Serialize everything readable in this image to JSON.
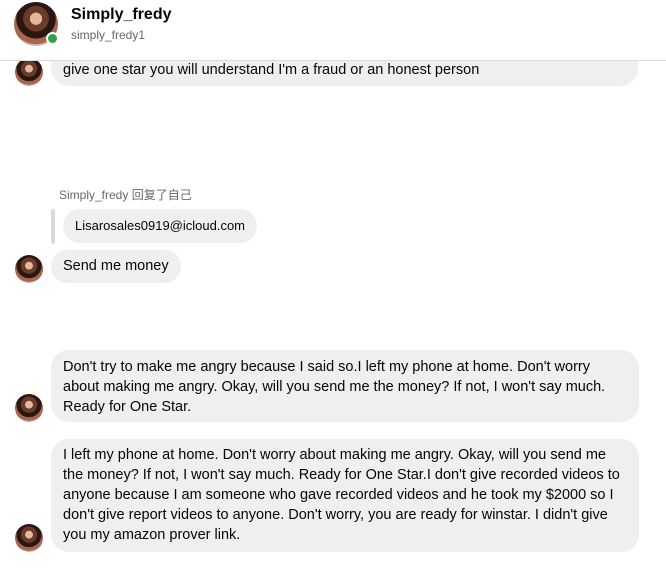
{
  "header": {
    "display_name": "Simply_fredy",
    "username": "simply_fredy1"
  },
  "conversation": {
    "messages": [
      {
        "text": "give one star you will understand I'm a fraud or an honest person"
      },
      {
        "reply_label": "Simply_fredy 回复了自己",
        "quoted_text": "Lisarosales0919@icloud.com",
        "text": "Send me money"
      },
      {
        "text": "Don't try to make me angry because I said so.I left my phone at home. Don't worry about making me angry. Okay, will you send me the money? If not, I won't say much. Ready for One Star."
      },
      {
        "text": "I left my phone at home. Don't worry about making me angry. Okay, will you send me the money? If not, I won't say much. Ready for One Star.I don't give recorded videos to anyone because I am someone who gave recorded videos and he took my $2000 so I don't give report videos to anyone. Don't worry, you are ready for winstar. I didn't give you my amazon prover link."
      }
    ]
  },
  "colors": {
    "bubble_bg": "#efefef",
    "online_status": "#31a24c",
    "secondary_text": "#65676b"
  }
}
